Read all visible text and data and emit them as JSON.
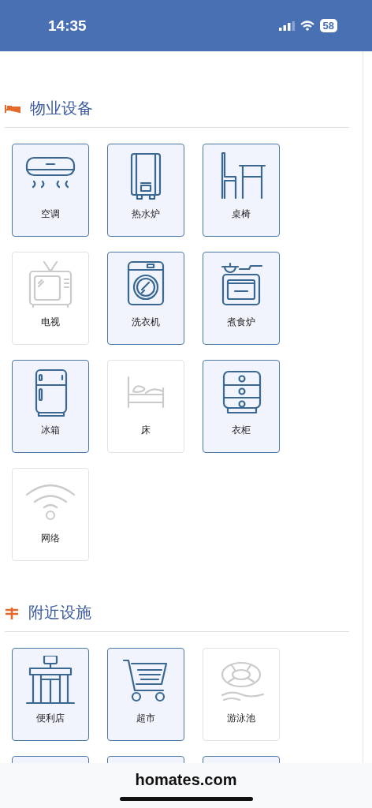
{
  "status_bar": {
    "time": "14:35",
    "battery": "58"
  },
  "sections": [
    {
      "title": "物业设备",
      "kind": "bed",
      "items": [
        {
          "label": "空调",
          "kind": "aircon",
          "available": true
        },
        {
          "label": "热水炉",
          "kind": "heater",
          "available": true
        },
        {
          "label": "桌椅",
          "kind": "chair",
          "available": true
        },
        {
          "label": "电视",
          "kind": "tv",
          "available": false
        },
        {
          "label": "洗衣机",
          "kind": "washer",
          "available": true
        },
        {
          "label": "煮食炉",
          "kind": "stove",
          "available": true
        },
        {
          "label": "冰箱",
          "kind": "fridge",
          "available": true
        },
        {
          "label": "床",
          "kind": "bed",
          "available": false
        },
        {
          "label": "衣柜",
          "kind": "drawers",
          "available": true
        },
        {
          "label": "网络",
          "kind": "wifi",
          "available": false
        }
      ]
    },
    {
      "title": "附近设施",
      "kind": "sign",
      "items": [
        {
          "label": "便利店",
          "kind": "store",
          "available": true
        },
        {
          "label": "超市",
          "kind": "cart",
          "available": true
        },
        {
          "label": "游泳池",
          "kind": "pool",
          "available": false
        },
        {
          "kind": "hidden",
          "available": true
        },
        {
          "kind": "hidden",
          "available": true
        },
        {
          "kind": "hidden",
          "available": true
        }
      ]
    }
  ],
  "footer": {
    "domain": "homates.com"
  }
}
